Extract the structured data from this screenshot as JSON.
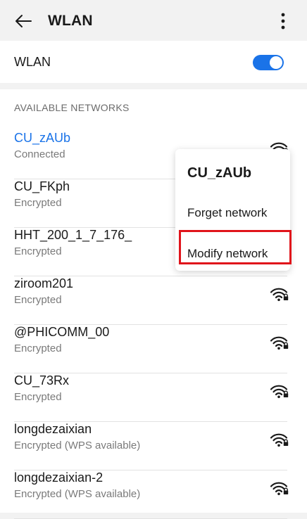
{
  "header": {
    "title": "WLAN"
  },
  "wlan_toggle": {
    "label": "WLAN",
    "state": "on",
    "color": "#1a73e8"
  },
  "section": {
    "title": "AVAILABLE NETWORKS"
  },
  "networks": [
    {
      "name": "CU_zAUb",
      "status": "Connected",
      "icon": "wifi-lock-icon"
    },
    {
      "name": "CU_FKph",
      "status": "Encrypted",
      "icon": "wifi-lock-icon"
    },
    {
      "name": "HHT_200_1_7_176_",
      "status": "Encrypted",
      "icon": "wifi-lock-icon"
    },
    {
      "name": "ziroom201",
      "status": "Encrypted",
      "icon": "wifi-lock-icon"
    },
    {
      "name": "@PHICOMM_00",
      "status": "Encrypted",
      "icon": "wifi-lock-icon"
    },
    {
      "name": "CU_73Rx",
      "status": "Encrypted",
      "icon": "wifi-lock-icon"
    },
    {
      "name": "longdezaixian",
      "status": "Encrypted (WPS available)",
      "icon": "wifi-lock-icon"
    },
    {
      "name": "longdezaixian-2",
      "status": "Encrypted (WPS available)",
      "icon": "wifi-lock-icon"
    }
  ],
  "context_menu": {
    "title": "CU_zAUb",
    "items": [
      "Forget network",
      "Modify network"
    ],
    "highlighted_item": "Modify network",
    "highlight_color": "#e0141b"
  }
}
